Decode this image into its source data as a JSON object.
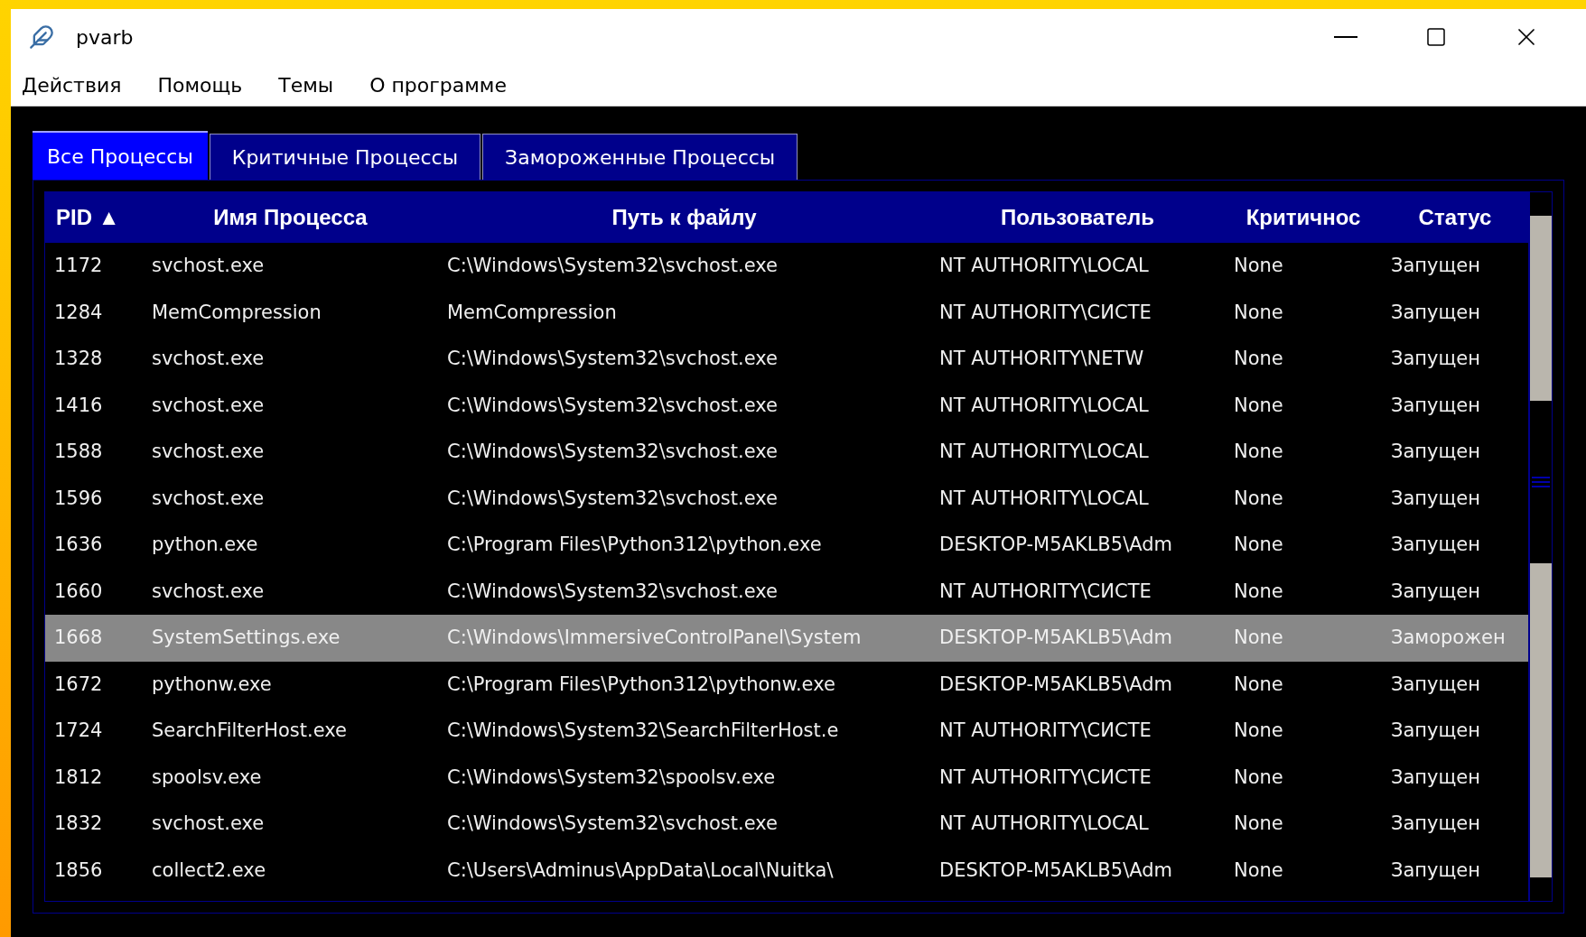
{
  "window": {
    "title": "pvarb"
  },
  "menu": [
    "Действия",
    "Помощь",
    "Темы",
    "О программе"
  ],
  "tabs": [
    {
      "label": "Все Процессы",
      "selected": true
    },
    {
      "label": "Критичные Процессы",
      "selected": false
    },
    {
      "label": "Замороженные Процессы",
      "selected": false
    }
  ],
  "table": {
    "columns": [
      "PID ▲",
      "Имя Процесса",
      "Путь к файлу",
      "Пользователь",
      "Критичнос",
      "Статус"
    ],
    "rows": [
      {
        "cells": [
          "1172",
          "svchost.exe",
          "C:\\Windows\\System32\\svchost.exe",
          "NT AUTHORITY\\LOCAL",
          "None",
          "Запущен"
        ],
        "selected": false
      },
      {
        "cells": [
          "1284",
          "MemCompression",
          "MemCompression",
          "NT AUTHORITY\\СИСТЕ",
          "None",
          "Запущен"
        ],
        "selected": false
      },
      {
        "cells": [
          "1328",
          "svchost.exe",
          "C:\\Windows\\System32\\svchost.exe",
          "NT AUTHORITY\\NETW",
          "None",
          "Запущен"
        ],
        "selected": false
      },
      {
        "cells": [
          "1416",
          "svchost.exe",
          "C:\\Windows\\System32\\svchost.exe",
          "NT AUTHORITY\\LOCAL",
          "None",
          "Запущен"
        ],
        "selected": false
      },
      {
        "cells": [
          "1588",
          "svchost.exe",
          "C:\\Windows\\System32\\svchost.exe",
          "NT AUTHORITY\\LOCAL",
          "None",
          "Запущен"
        ],
        "selected": false
      },
      {
        "cells": [
          "1596",
          "svchost.exe",
          "C:\\Windows\\System32\\svchost.exe",
          "NT AUTHORITY\\LOCAL",
          "None",
          "Запущен"
        ],
        "selected": false
      },
      {
        "cells": [
          "1636",
          "python.exe",
          "C:\\Program Files\\Python312\\python.exe",
          "DESKTOP-M5AKLB5\\Adm",
          "None",
          "Запущен"
        ],
        "selected": false
      },
      {
        "cells": [
          "1660",
          "svchost.exe",
          "C:\\Windows\\System32\\svchost.exe",
          "NT AUTHORITY\\СИСТЕ",
          "None",
          "Запущен"
        ],
        "selected": false
      },
      {
        "cells": [
          "1668",
          "SystemSettings.exe",
          "C:\\Windows\\ImmersiveControlPanel\\System",
          "DESKTOP-M5AKLB5\\Adm",
          "None",
          "Заморожен"
        ],
        "selected": true
      },
      {
        "cells": [
          "1672",
          "pythonw.exe",
          "C:\\Program Files\\Python312\\pythonw.exe",
          "DESKTOP-M5AKLB5\\Adm",
          "None",
          "Запущен"
        ],
        "selected": false
      },
      {
        "cells": [
          "1724",
          "SearchFilterHost.exe",
          "C:\\Windows\\System32\\SearchFilterHost.e",
          "NT AUTHORITY\\СИСТЕ",
          "None",
          "Запущен"
        ],
        "selected": false
      },
      {
        "cells": [
          "1812",
          "spoolsv.exe",
          "C:\\Windows\\System32\\spoolsv.exe",
          "NT AUTHORITY\\СИСТЕ",
          "None",
          "Запущен"
        ],
        "selected": false
      },
      {
        "cells": [
          "1832",
          "svchost.exe",
          "C:\\Windows\\System32\\svchost.exe",
          "NT AUTHORITY\\LOCAL",
          "None",
          "Запущен"
        ],
        "selected": false
      },
      {
        "cells": [
          "1856",
          "collect2.exe",
          "C:\\Users\\Adminus\\AppData\\Local\\Nuitka\\",
          "DESKTOP-M5AKLB5\\Adm",
          "None",
          "Запущен"
        ],
        "selected": false
      }
    ]
  }
}
